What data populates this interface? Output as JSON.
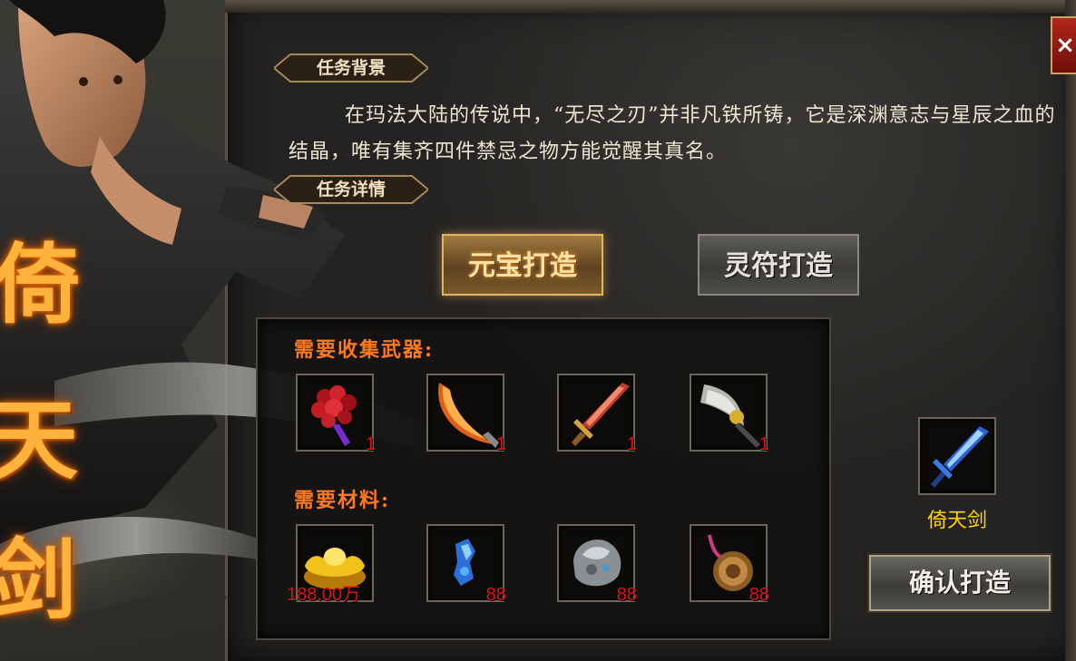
{
  "window": {
    "close_label": "×"
  },
  "banner": {
    "characters": [
      "倚",
      "天",
      "剑"
    ]
  },
  "sections": {
    "background_title": "任务背景",
    "detail_title": "任务详情"
  },
  "story": {
    "text": "在玛法大陆的传说中，“无尽之刃”并非凡铁所铸，它是深渊意志与星辰之血的结晶，唯有集齐四件禁忌之物方能觉醒其真名。"
  },
  "modes": {
    "ingot": "元宝打造",
    "talisman": "灵符打造",
    "active": "ingot"
  },
  "requirements": {
    "weapons_label": "需要收集武器:",
    "weapons": [
      {
        "icon": "rose-bouquet-icon",
        "qty": "1"
      },
      {
        "icon": "flame-blade-icon",
        "qty": "1"
      },
      {
        "icon": "red-sword-icon",
        "qty": "1"
      },
      {
        "icon": "crescent-axe-icon",
        "qty": "1"
      }
    ],
    "materials_label": "需要材料:",
    "materials": [
      {
        "icon": "gold-ingot-icon",
        "qty": "188.00万"
      },
      {
        "icon": "blue-crystal-icon",
        "qty": "88"
      },
      {
        "icon": "silver-ore-icon",
        "qty": "88"
      },
      {
        "icon": "bronze-medal-icon",
        "qty": "88"
      }
    ]
  },
  "reward": {
    "icon": "blue-sword-icon",
    "name": "倚天剑"
  },
  "actions": {
    "confirm": "确认打造"
  },
  "colors": {
    "qty_red": "#e0130d",
    "label_orange": "#ff7a1a",
    "reward_yellow": "#ffd500",
    "title_gold": "#ffb23c"
  }
}
